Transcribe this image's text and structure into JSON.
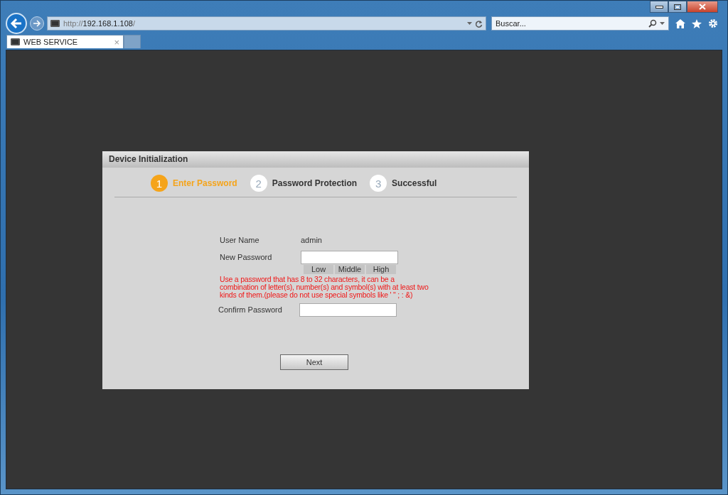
{
  "browser": {
    "address": {
      "scheme": "http://",
      "host": "192.168.1.108",
      "tail": "/"
    },
    "search": {
      "placeholder": "Buscar..."
    },
    "tabs": [
      {
        "label": "WEB SERVICE",
        "close": "×",
        "selected": true
      }
    ]
  },
  "dialog": {
    "title": "Device Initialization",
    "steps": [
      {
        "number": "1",
        "label": "Enter Password",
        "selected": true
      },
      {
        "number": "2",
        "label": "Password Protection",
        "selected": false
      },
      {
        "number": "3",
        "label": "Successful",
        "selected": false
      }
    ],
    "user_name": {
      "label": "User Name",
      "value": "admin"
    },
    "new_password": {
      "label": "New Password"
    },
    "strength": [
      "Low",
      "Middle",
      "High"
    ],
    "hint": "Use a password that has 8 to 32 characters, it can be a combination of letter(s), number(s) and symbol(s) with at least two kinds of them.(please do not use special symbols like ' \" ; : &)",
    "confirm_password": {
      "label": "Confirm Password"
    },
    "button": "Next"
  }
}
